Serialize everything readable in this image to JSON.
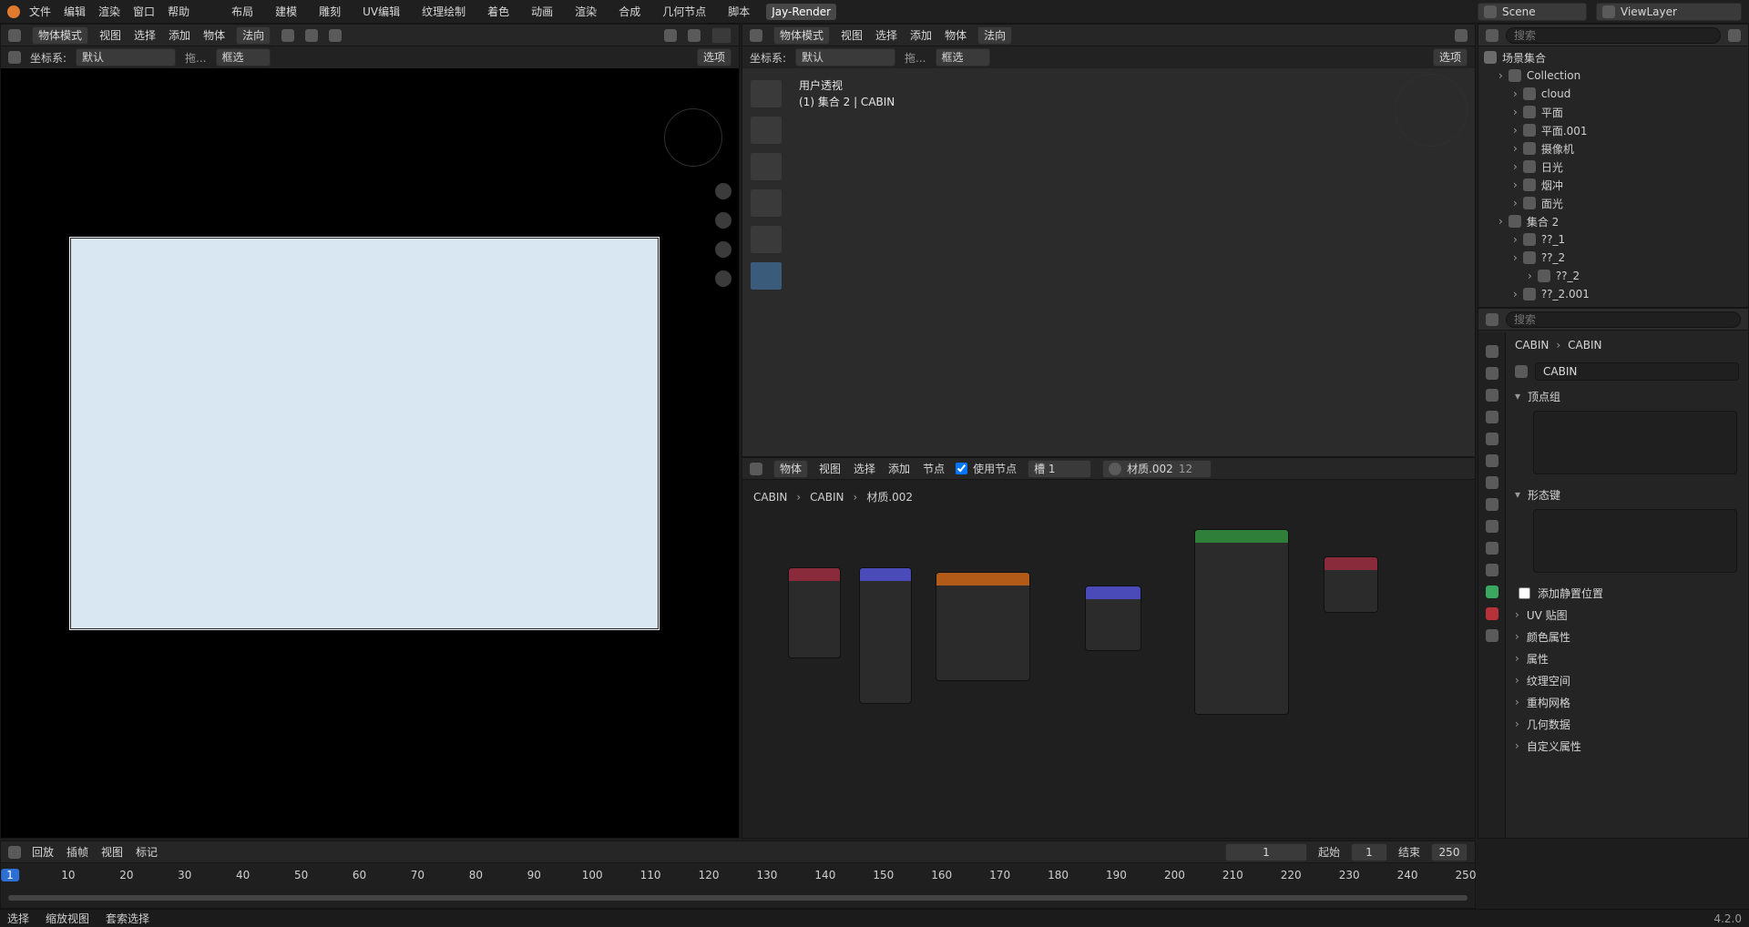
{
  "topbar": {
    "menus": [
      "文件",
      "编辑",
      "渲染",
      "窗口",
      "帮助"
    ],
    "workspaces": [
      "布局",
      "建模",
      "雕刻",
      "UV编辑",
      "纹理绘制",
      "着色",
      "动画",
      "渲染",
      "合成",
      "几何节点",
      "脚本",
      "Jay-Render"
    ],
    "active_workspace": "Jay-Render",
    "scene": "Scene",
    "viewlayer": "ViewLayer"
  },
  "left_view": {
    "mode": "物体模式",
    "menus": [
      "视图",
      "选择",
      "添加",
      "物体"
    ],
    "transform": "法向",
    "coord_label": "坐标系:",
    "coord_value": "默认",
    "drag_label": "拖...",
    "select_mode": "框选",
    "options": "选项"
  },
  "right_view": {
    "mode": "物体模式",
    "menus": [
      "视图",
      "选择",
      "添加",
      "物体"
    ],
    "transform": "法向",
    "coord_label": "坐标系:",
    "coord_value": "默认",
    "drag_label": "拖...",
    "select_mode": "框选",
    "options": "选项",
    "overlay_line1": "用户透视",
    "overlay_line2": "(1) 集合 2 | CABIN"
  },
  "node_editor": {
    "type": "物体",
    "menus": [
      "视图",
      "选择",
      "添加",
      "节点"
    ],
    "use_nodes": "使用节点",
    "slot": "槽 1",
    "material": "材质.002",
    "users": "12",
    "breadcrumb": [
      "CABIN",
      "CABIN",
      "材质.002"
    ]
  },
  "outliner": {
    "search_placeholder": "搜索",
    "root": "场景集合",
    "items": [
      {
        "label": "Collection",
        "indent": 1
      },
      {
        "label": "cloud",
        "indent": 2
      },
      {
        "label": "平面",
        "indent": 2
      },
      {
        "label": "平面.001",
        "indent": 2
      },
      {
        "label": "摄像机",
        "indent": 2
      },
      {
        "label": "日光",
        "indent": 2
      },
      {
        "label": "烟冲",
        "indent": 2
      },
      {
        "label": "面光",
        "indent": 2
      },
      {
        "label": "集合 2",
        "indent": 1
      },
      {
        "label": "??_1",
        "indent": 2
      },
      {
        "label": "??_2",
        "indent": 2
      },
      {
        "label": "??_2",
        "indent": 3
      },
      {
        "label": "??_2.001",
        "indent": 2
      }
    ]
  },
  "properties": {
    "search_placeholder": "搜索",
    "breadcrumb": [
      "CABIN",
      "CABIN"
    ],
    "datablock": "CABIN",
    "sections_open": [
      "顶点组",
      "形态键"
    ],
    "add_rest_position": "添加静置位置",
    "sections_closed": [
      "UV 贴图",
      "颜色属性",
      "属性",
      "纹理空间",
      "重构网格",
      "几何数据",
      "自定义属性"
    ]
  },
  "timeline": {
    "menus": [
      "回放",
      "插帧",
      "视图",
      "标记"
    ],
    "current_frame": "1",
    "start_label": "起始",
    "start": "1",
    "end_label": "结束",
    "end": "250",
    "ruler": [
      "1",
      "10",
      "20",
      "30",
      "40",
      "50",
      "60",
      "70",
      "80",
      "90",
      "100",
      "110",
      "120",
      "130",
      "140",
      "150",
      "160",
      "170",
      "180",
      "190",
      "200",
      "210",
      "220",
      "230",
      "240",
      "250"
    ]
  },
  "status": {
    "select": "选择",
    "zoom": "缩放视图",
    "lasso": "套索选择",
    "version": "4.2.0"
  }
}
